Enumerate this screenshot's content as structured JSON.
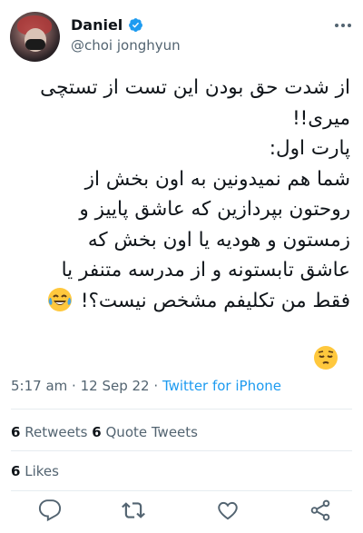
{
  "user": {
    "name": "Daniel",
    "handle": "@choi jonghyun"
  },
  "tweet": {
    "lines": [
      "از شدت حق بودن این تست از تستچی",
      "میری!!",
      "پارت اول:",
      "شما هم نمیدونین به اون بخش از",
      "روحتون بپردازین که عاشق پاییز و",
      "زمستون و هودیه یا اون بخش که",
      "عاشق تابستونه و از مدرسه متنفر یا",
      "فقط من تکلیفم مشخص نیست؟!"
    ],
    "emojis": [
      "laughing-crying-emoji",
      "pensive-emoji"
    ]
  },
  "meta": {
    "time": "5:17 am",
    "sep": "·",
    "date": "12 Sep 22",
    "source": "Twitter for iPhone"
  },
  "stats": {
    "retweets_count": "6",
    "retweets_label": "Retweets",
    "quotes_count": "6",
    "quotes_label": "Quote Tweets",
    "likes_count": "6",
    "likes_label": "Likes"
  },
  "actions": [
    "reply-icon",
    "retweet-icon",
    "like-icon",
    "share-icon"
  ],
  "colors": {
    "link": "#1d9bf0",
    "verified": "#1d9bf0",
    "muted": "#536471",
    "text": "#0f1419"
  }
}
